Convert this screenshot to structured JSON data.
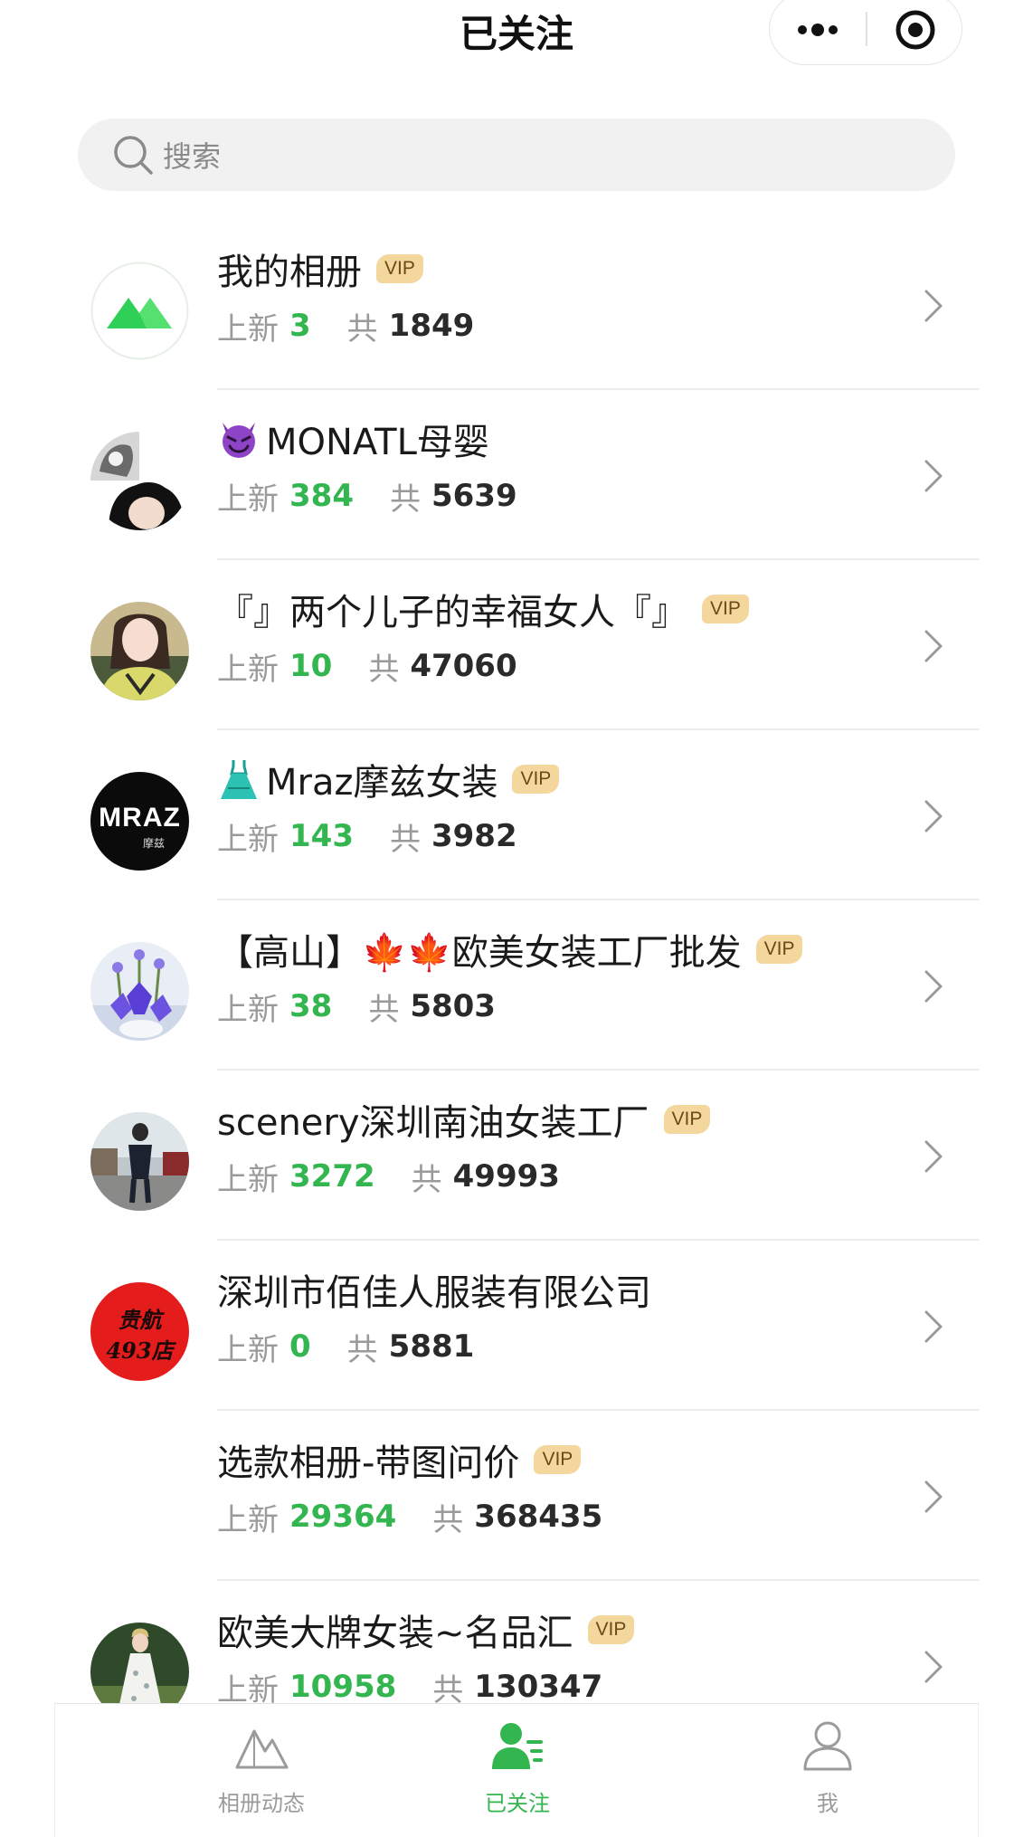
{
  "header": {
    "title": "已关注"
  },
  "search": {
    "placeholder": "搜索"
  },
  "stat_labels": {
    "new": "上新",
    "total": "共"
  },
  "vip_label": "VIP",
  "albums": [
    {
      "name": "我的相册",
      "vip": true,
      "new_count": "3",
      "total": "1849",
      "avatar": "green-mountain-logo"
    },
    {
      "name": "MONATL母婴",
      "prefix_icon": "devil-emoji-icon",
      "vip": false,
      "new_count": "384",
      "total": "5639",
      "avatar": "photo-collage"
    },
    {
      "name": "『』两个儿子的幸福女人『』",
      "vip": true,
      "new_count": "10",
      "total": "47060",
      "avatar": "photo-woman"
    },
    {
      "name": "Mraz摩兹女装",
      "prefix_icon": "dress-emoji-icon",
      "vip": true,
      "new_count": "143",
      "total": "3982",
      "avatar": "mraz-logo",
      "avatar_text": "MRAZ",
      "avatar_subtext": "摩兹"
    },
    {
      "name": "【高山】🍁🍁欧美女装工厂批发",
      "vip": true,
      "new_count": "38",
      "total": "5803",
      "avatar": "photo-flowers"
    },
    {
      "name": "scenery深圳南油女装工厂",
      "vip": true,
      "new_count": "3272",
      "total": "49993",
      "avatar": "photo-street"
    },
    {
      "name": "深圳市佰佳人服装有限公司",
      "vip": false,
      "new_count": "0",
      "total": "5881",
      "avatar": "red-seal",
      "avatar_text": "贵航",
      "avatar_subtext": "493店"
    },
    {
      "name": "选款相册-带图问价",
      "vip": true,
      "new_count": "29364",
      "total": "368435",
      "avatar": "blank"
    },
    {
      "name": "欧美大牌女装~名品汇",
      "vip": true,
      "new_count": "10958",
      "total": "130347",
      "avatar": "photo-dress"
    }
  ],
  "tabs": [
    {
      "label": "相册动态",
      "icon": "mountain-icon",
      "active": false
    },
    {
      "label": "已关注",
      "icon": "followed-user-icon",
      "active": true
    },
    {
      "label": "我",
      "icon": "user-icon",
      "active": false
    }
  ],
  "colors": {
    "accent_green": "#33b54f",
    "vip_bg": "#f3d79c",
    "background": "#ffffff"
  }
}
